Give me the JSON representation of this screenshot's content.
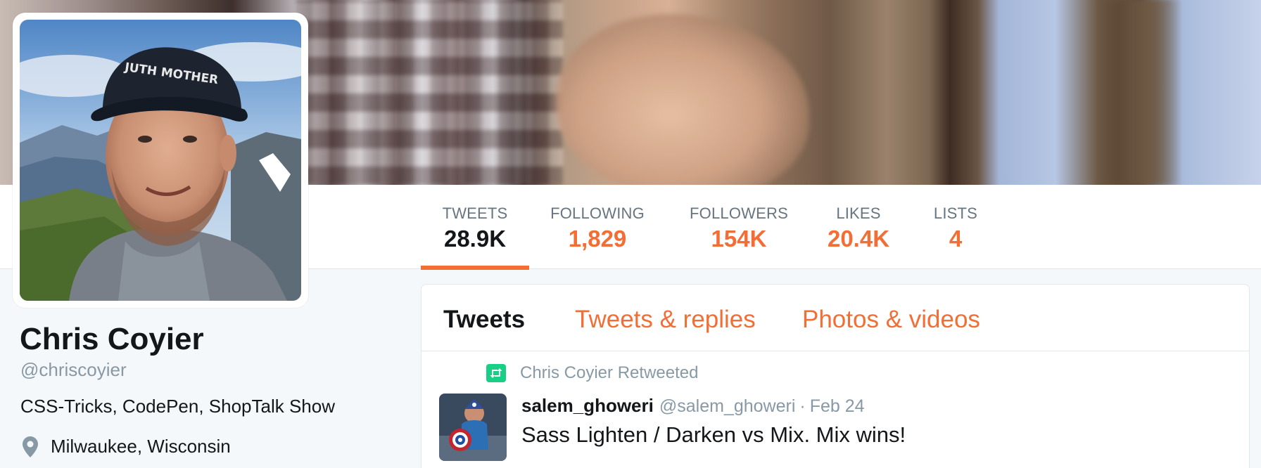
{
  "profile": {
    "name": "Chris Coyier",
    "handle": "@chriscoyier",
    "bio": "CSS-Tricks, CodePen, ShopTalk Show",
    "location": "Milwaukee, Wisconsin",
    "cap_text": "JUTH MOTHER"
  },
  "nav": {
    "stats": [
      {
        "label": "TWEETS",
        "value": "28.9K",
        "active": true
      },
      {
        "label": "FOLLOWING",
        "value": "1,829"
      },
      {
        "label": "FOLLOWERS",
        "value": "154K"
      },
      {
        "label": "LIKES",
        "value": "20.4K"
      },
      {
        "label": "LISTS",
        "value": "4"
      }
    ]
  },
  "timeline": {
    "tabs": [
      "Tweets",
      "Tweets & replies",
      "Photos & videos"
    ],
    "active_tab": "Tweets",
    "tweet": {
      "retweet_label": "Chris Coyier Retweeted",
      "author": "salem_ghoweri",
      "handle": "@salem_ghoweri",
      "separator": "·",
      "date": "Feb 24",
      "text": "Sass Lighten / Darken vs Mix. Mix wins!"
    }
  },
  "icons": {
    "location": "map-pin-icon",
    "retweet": "retweet-icon"
  },
  "colors": {
    "accent": "#f26e35",
    "text": "#14171a",
    "muted": "#8899a6",
    "retweet_green": "#19cf86",
    "background": "#f5f8fa"
  }
}
